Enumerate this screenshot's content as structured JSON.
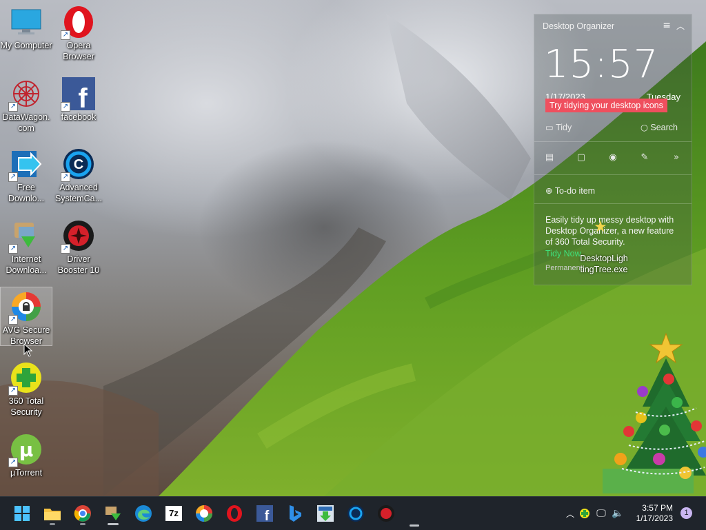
{
  "desktop": {
    "icons": [
      {
        "label": "My Computer",
        "icon": "monitor-icon"
      },
      {
        "label": "Opera Browser",
        "icon": "opera-icon"
      },
      {
        "label": "DataWagon. com",
        "icon": "datawagon-icon"
      },
      {
        "label": "facebook",
        "icon": "facebook-icon"
      },
      {
        "label": "Free Downlo...",
        "icon": "download-arrow-icon"
      },
      {
        "label": "Advanced SystemCa...",
        "icon": "advanced-systemcare-icon"
      },
      {
        "label": "Internet Downloa...",
        "icon": "internet-download-manager-icon"
      },
      {
        "label": "Driver Booster 10",
        "icon": "driver-booster-icon"
      },
      {
        "label": "AVG Secure Browser",
        "icon": "avg-secure-browser-icon"
      },
      {
        "label": "360 Total Security",
        "icon": "360-total-security-icon"
      },
      {
        "label": "µTorrent",
        "icon": "utorrent-icon"
      }
    ]
  },
  "organizer": {
    "title": "Desktop Organizer",
    "time": "15:57",
    "date": "1/17/2023",
    "day": "Tuesday",
    "tip": "Try tidying your desktop icons",
    "tidy": "Tidy",
    "search": "Search",
    "todo": "To-do item",
    "description": "Easily tidy up messy desktop with Desktop Organizer, a new feature of 360 Total Security.",
    "tidy_now": "Tidy Now",
    "permanent": "Permanent",
    "file_label": "DesktopLigh tingTree.exe"
  },
  "taskbar": {
    "apps": [
      "start-icon",
      "file-explorer-icon",
      "chrome-icon",
      "internet-download-manager-icon",
      "edge-icon",
      "7zip-icon",
      "avg-secure-browser-icon",
      "opera-icon",
      "facebook-icon",
      "bing-icon",
      "free-download-manager-icon",
      "advanced-systemcare-icon",
      "driver-booster-icon"
    ],
    "seven_zip": "7z",
    "clock_time": "3:57 PM",
    "clock_date": "1/17/2023",
    "notification_count": "1"
  }
}
